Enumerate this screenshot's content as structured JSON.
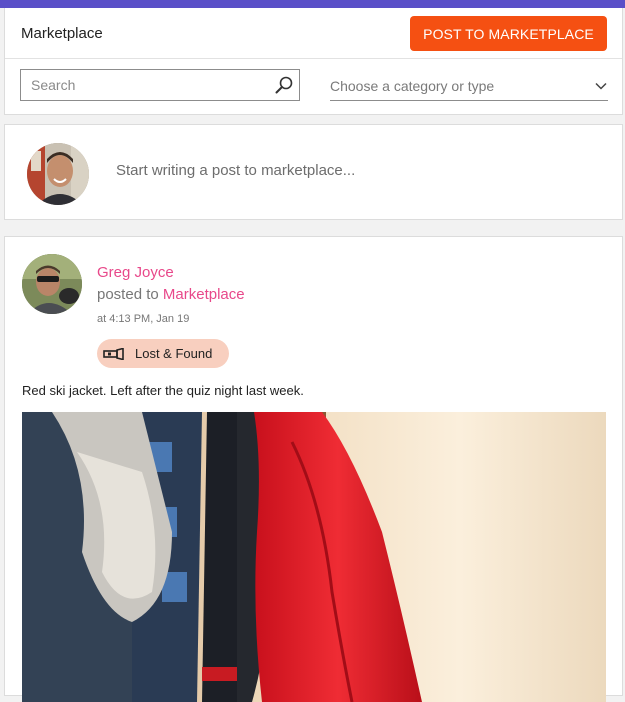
{
  "header": {
    "title": "Marketplace",
    "post_button_label": "POST TO MARKETPLACE"
  },
  "filters": {
    "search_placeholder": "Search",
    "category_placeholder": "Choose a category or type",
    "search_icon": "search-icon",
    "dropdown_icon": "chevron-down-icon"
  },
  "composer": {
    "placeholder": "Start writing a post to marketplace..."
  },
  "post": {
    "author": "Greg Joyce",
    "posted_to_prefix": "posted to",
    "posted_to_location": "Marketplace",
    "timestamp": "at  4:13 PM, Jan 19",
    "tag_label": "Lost & Found",
    "tag_icon": "flashlight-icon",
    "body": "Red ski jacket. Left after the quiz night last week."
  },
  "colors": {
    "accent_top_bar": "#5a4fc8",
    "post_button": "#f55012",
    "link_pink": "#e8488a",
    "tag_background": "#f8cfbf"
  }
}
